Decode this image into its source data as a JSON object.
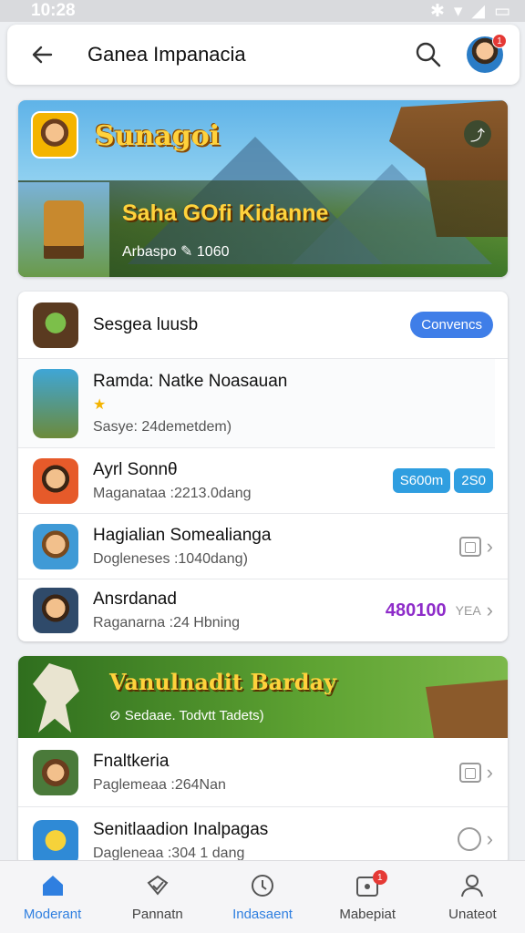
{
  "status_bar": {
    "time": "10:28"
  },
  "app_bar": {
    "title": "Ganea Impanacia",
    "avatar_badge": "1"
  },
  "hero": {
    "brand_title": "Sunagoi",
    "game_title": "Saha GOfi Kidanne",
    "subtitle": "Arbaspo",
    "rating_count": "1060"
  },
  "list_card": {
    "header": {
      "title": "Sesgea luusb",
      "button_label": "Convencs"
    },
    "featured": {
      "title": "Ramda: Natke Noasauan",
      "star": "★",
      "meta": "Sasye: 24demetdem)"
    },
    "items": [
      {
        "title": "Ayrl Sonnθ",
        "subtitle": "Maganataa :2213.0dang",
        "pill_left": "S600m",
        "pill_right": "2S0"
      },
      {
        "title": "Hagialian Somealianga",
        "subtitle": "Dogleneses :1040dang)"
      },
      {
        "title": "Ansrdanad",
        "subtitle": "Raganarna :24 Hbning",
        "price": "480100",
        "price_unit": "YEA"
      }
    ]
  },
  "section2": {
    "banner_title": "Vanulnadit Barday",
    "banner_sub": "Sedaae. Todvtt Tadets)",
    "items": [
      {
        "title": "Fnaltkeria",
        "subtitle": "Paglemeaa :264Nan"
      },
      {
        "title": "Senitlaadion Inalpagas",
        "subtitle": "Dagleneaa :304 1 dang"
      }
    ]
  },
  "bottom_nav": [
    {
      "label": "Moderant",
      "icon": "home-icon",
      "active": true
    },
    {
      "label": "Pannatn",
      "icon": "library-icon",
      "active": false
    },
    {
      "label": "Indasaent",
      "icon": "discover-icon",
      "active": false
    },
    {
      "label": "Mabepiat",
      "icon": "notifications-icon",
      "active": false,
      "badge": "1"
    },
    {
      "label": "Unateot",
      "icon": "profile-icon",
      "active": false
    }
  ],
  "colors": {
    "accent": "#2f7fe0",
    "price": "#8e2cc9",
    "badge": "#e53935"
  }
}
